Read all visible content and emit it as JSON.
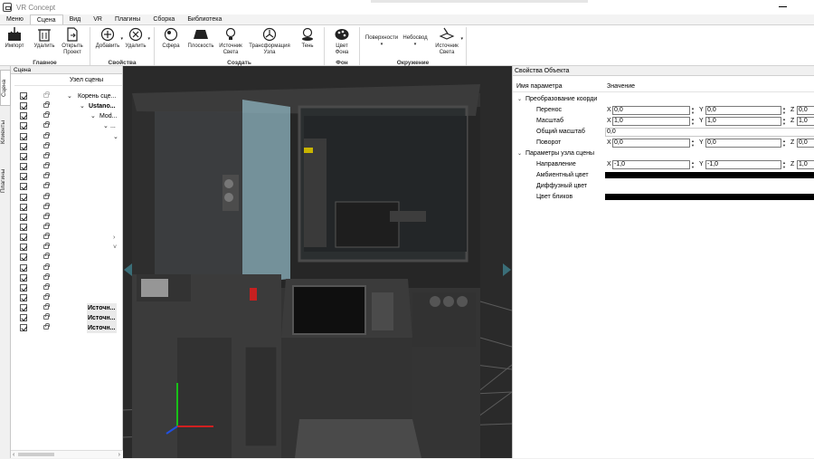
{
  "window": {
    "title": "VR Concept"
  },
  "ribbon_tabs": [
    {
      "label": "Меню"
    },
    {
      "label": "Сцена",
      "active": true
    },
    {
      "label": "Вид"
    },
    {
      "label": "VR"
    },
    {
      "label": "Плагины"
    },
    {
      "label": "Сборка"
    },
    {
      "label": "Библиотека"
    }
  ],
  "ribbon": {
    "groups": {
      "main": {
        "title": "Главное",
        "import": "Импорт",
        "delete": "Удалить",
        "open_l1": "Открыть",
        "open_l2": "Проект"
      },
      "props": {
        "title": "Свойства",
        "add": "Добавить",
        "remove": "Удалить"
      },
      "create": {
        "title": "Создать",
        "sphere": "Сфера",
        "plane": "Плоскость",
        "light_l1": "Источник",
        "light_l2": "Света",
        "transform_l1": "Трансформация",
        "transform_l2": "Узла",
        "shadow": "Тень"
      },
      "background": {
        "title": "Фон",
        "color_l1": "Цвет",
        "color_l2": "Фона"
      },
      "environment": {
        "title": "Окружение",
        "surfaces": "Поверхности",
        "sky": "Небосвод",
        "light_l1": "Источник",
        "light_l2": "Света"
      }
    }
  },
  "side_tabs": [
    "Сцена",
    "Клиенты",
    "Плагины"
  ],
  "scene_panel": {
    "title": "Сцена",
    "column_header": "Узел сцены",
    "items": [
      {
        "label": "Корень сце...",
        "bold": false
      },
      {
        "label": "Ustano...",
        "bold": true
      },
      {
        "label": "Mod...",
        "bold": false
      },
      {
        "label": "...",
        "bold": false
      },
      {
        "label": "Источн...",
        "bold": true
      },
      {
        "label": "Источн...",
        "bold": true
      },
      {
        "label": "Источн...",
        "bold": true
      }
    ]
  },
  "properties": {
    "title": "Свойства Объекта",
    "col_name": "Имя параметра",
    "col_value": "Значение",
    "transform_section": "Преобразование коорди",
    "translate": {
      "label": "Перенос",
      "x": "0,0",
      "y": "0,0",
      "z": "0,0"
    },
    "scale": {
      "label": "Масштаб",
      "x": "1,0",
      "y": "1,0",
      "z": "1,0"
    },
    "uniform_scale": {
      "label": "Общий масштаб",
      "value": "0,0"
    },
    "rotation": {
      "label": "Поворот",
      "x": "0,0",
      "y": "0,0",
      "z": "0,0"
    },
    "node_section": "Параметры узла сцены",
    "direction": {
      "label": "Направление",
      "x": "-1,0",
      "y": "-1,0",
      "z": "1,0"
    },
    "ambient": {
      "label": "Амбиентный цвет"
    },
    "diffuse": {
      "label": "Диффузный цвет"
    },
    "specular": {
      "label": "Цвет бликов"
    }
  },
  "axis_letters": {
    "x": "X",
    "y": "Y",
    "z": "Z"
  },
  "colors": {
    "viewport_bg": "#2a2a2a",
    "accent_nav": "#3a6e78",
    "panel_glass": "#8fb5c2"
  }
}
